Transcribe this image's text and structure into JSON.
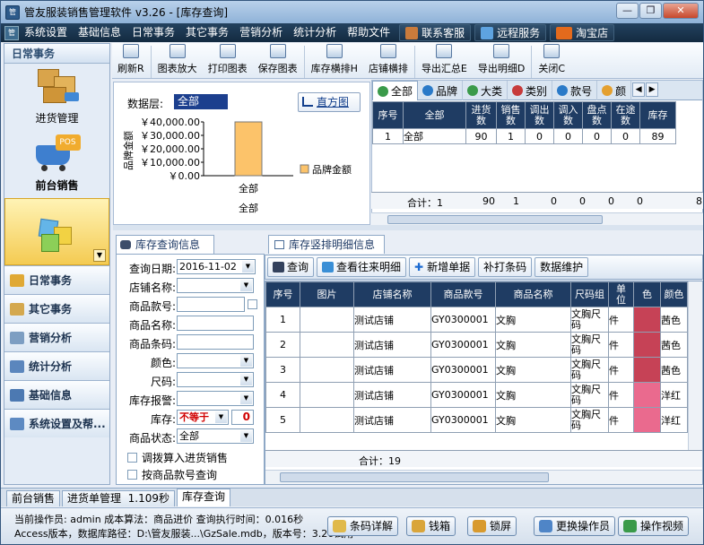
{
  "window": {
    "title_app": "管友服装销售管理软件",
    "version": "v3.26",
    "dash": "-",
    "title_doc": "[库存查询]",
    "min": "—",
    "max": "❐",
    "close": "✕"
  },
  "menu": {
    "items": [
      "系统设置",
      "基础信息",
      "日常事务",
      "其它事务",
      "营销分析",
      "统计分析",
      "帮助文件"
    ],
    "service": "联系客服",
    "remote": "远程服务",
    "taobao": "淘宝店"
  },
  "sidebar": {
    "header": "日常事务",
    "big": [
      {
        "label": "进货管理"
      },
      {
        "label": "前台销售"
      },
      {
        "label": ""
      }
    ],
    "items": [
      {
        "label": "日常事务"
      },
      {
        "label": "其它事务"
      },
      {
        "label": "营销分析"
      },
      {
        "label": "统计分析"
      },
      {
        "label": "基础信息"
      },
      {
        "label": "系统设置及帮..."
      }
    ]
  },
  "toolbar": {
    "buttons": [
      "刷新R",
      "图表放大",
      "打印图表",
      "保存图表",
      "库存横排H",
      "店铺横排",
      "导出汇总E",
      "导出明细D",
      "关闭C"
    ]
  },
  "chart": {
    "ds_label": "数据层:",
    "ds_value": "全部",
    "hist_btn": "直方图"
  },
  "chart_data": {
    "type": "bar",
    "categories": [
      "全部"
    ],
    "series": [
      {
        "name": "品牌金额",
        "values": [
          40000
        ],
        "color": "#fcc36a"
      }
    ],
    "ylabel": "品牌金额",
    "xlabel": "全部",
    "ylim": [
      0,
      40000
    ],
    "yticks": [
      "￥40,000.00",
      "￥30,000.00",
      "￥20,000.00",
      "￥10,000.00",
      "￥0.00"
    ],
    "legend": "right"
  },
  "summary_tabs": [
    "全部",
    "品牌",
    "大类",
    "类别",
    "款号",
    "颜"
  ],
  "summary_table": {
    "headers": [
      "序号",
      "全部",
      "进货数",
      "销售数",
      "调出数",
      "调入数",
      "盘点数",
      "在途数",
      "库存"
    ],
    "rows": [
      [
        "1",
        "全部",
        "90",
        "1",
        "0",
        "0",
        "0",
        "0",
        "89"
      ]
    ],
    "total_label": "合计：1",
    "totals": [
      "90",
      "1",
      "0",
      "0",
      "0",
      "0",
      "8"
    ]
  },
  "query": {
    "tab": "库存查询信息",
    "fields": [
      {
        "label": "查询日期:",
        "value": "2016-11-02"
      },
      {
        "label": "店铺名称:",
        "value": ""
      },
      {
        "label": "商品款号:",
        "value": ""
      },
      {
        "label": "商品名称:",
        "value": ""
      },
      {
        "label": "商品条码:",
        "value": ""
      },
      {
        "label": "颜色:",
        "value": ""
      },
      {
        "label": "尺码:",
        "value": ""
      },
      {
        "label": "库存报警:",
        "value": ""
      },
      {
        "label": "库存:",
        "value": "不等于"
      },
      {
        "label": "商品状态:",
        "value": "全部"
      }
    ],
    "stock_num": "0",
    "chk1": "调拨算入进货销售",
    "chk2": "按商品款号查询"
  },
  "detail": {
    "tab": "库存竖排明细信息",
    "buttons": [
      "查询",
      "查看往来明细",
      "新增单据",
      "补打条码",
      "数据维护"
    ],
    "headers": [
      "序号",
      "图片",
      "店铺名称",
      "商品款号",
      "商品名称",
      "尺码组",
      "单位",
      "色",
      "颜色"
    ],
    "rows": [
      [
        "1",
        "",
        "测试店铺",
        "GY0300001",
        "文胸",
        "文胸尺码",
        "件",
        "#c64256",
        "茜色"
      ],
      [
        "2",
        "",
        "测试店铺",
        "GY0300001",
        "文胸",
        "文胸尺码",
        "件",
        "#c64256",
        "茜色"
      ],
      [
        "3",
        "",
        "测试店铺",
        "GY0300001",
        "文胸",
        "文胸尺码",
        "件",
        "#c64256",
        "茜色"
      ],
      [
        "4",
        "",
        "测试店铺",
        "GY0300001",
        "文胸",
        "文胸尺码",
        "件",
        "#ea6a8e",
        "洋红"
      ],
      [
        "5",
        "",
        "测试店铺",
        "GY0300001",
        "文胸",
        "文胸尺码",
        "件",
        "#ea6a8e",
        "洋红"
      ]
    ],
    "total_label": "合计：19"
  },
  "window_tabs": [
    "前台销售",
    "进货单管理",
    "1.109秒",
    "库存查询"
  ],
  "status": {
    "line1": "当前操作员: admin  成本算法：商品进价  查询执行时间：0.016秒",
    "line2": "Access版本，数据库路径：D:\\管友服装...\\GzSale.mdb，版本号：3.26试用",
    "buttons": [
      "条码详解",
      "钱箱",
      "锁屏",
      "更换操作员",
      "操作视频"
    ]
  }
}
